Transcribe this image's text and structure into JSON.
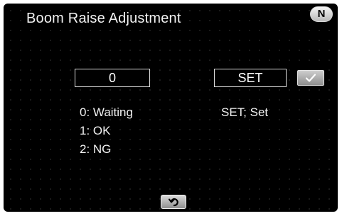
{
  "screen": {
    "title": "Boom Raise Adjustment",
    "mode_badge": "N"
  },
  "value_field": {
    "value": "0"
  },
  "set_field": {
    "label": "SET"
  },
  "status_legend": [
    "0: Waiting",
    "1: OK",
    "2: NG"
  ],
  "set_legend": "SET; Set",
  "icons": {
    "confirm": "checkmark-icon",
    "back": "return-arrow-icon"
  },
  "colors": {
    "background": "#000000",
    "text": "#f2f2f2",
    "button": "#b0b0b0"
  }
}
